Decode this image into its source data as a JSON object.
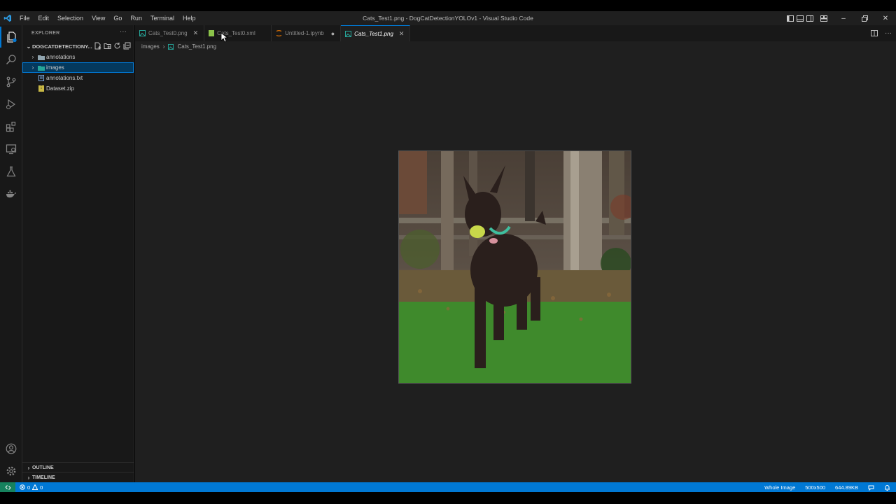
{
  "window": {
    "title": "Cats_Test1.png - DogCatDetectionYOLOv1 - Visual Studio Code",
    "menu": [
      "File",
      "Edit",
      "Selection",
      "View",
      "Go",
      "Run",
      "Terminal",
      "Help"
    ]
  },
  "sidebar": {
    "title": "EXPLORER",
    "project": "DOGCATDETECTIONY...",
    "tree": [
      {
        "label": "annotations",
        "type": "folder"
      },
      {
        "label": "images",
        "type": "folder",
        "selected": true
      },
      {
        "label": "annotations.txt",
        "type": "file"
      },
      {
        "label": "Dataset.zip",
        "type": "zip"
      }
    ],
    "outline": "OUTLINE",
    "timeline": "TIMELINE"
  },
  "tabs": [
    {
      "label": "Cats_Test0.png",
      "icon": "image-icon"
    },
    {
      "label": "Cats_Test0.xml",
      "icon": "xml-icon"
    },
    {
      "label": "Untitled-1.ipynb",
      "icon": "notebook-icon",
      "modified": true
    },
    {
      "label": "Cats_Test1.png",
      "icon": "image-icon",
      "active": true
    }
  ],
  "breadcrumb": {
    "folder": "images",
    "file": "Cats_Test1.png"
  },
  "statusbar": {
    "errors": "0",
    "warnings": "0",
    "zoom": "Whole Image",
    "dimensions": "500x500",
    "size": "644.89KB"
  },
  "colors": {
    "accent": "#0078d4",
    "statusbar": "#0078d4",
    "remote": "#16825d",
    "selection": "#04395e"
  }
}
